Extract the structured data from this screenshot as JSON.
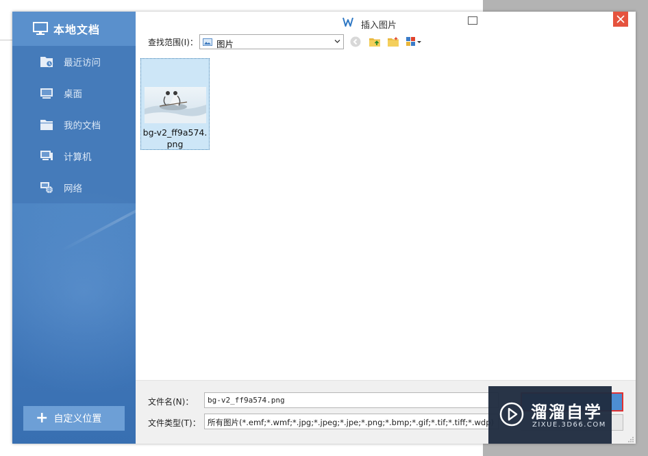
{
  "dialog": {
    "title": "插入图片",
    "window_controls": {
      "maximize_icon": "maximize-icon",
      "close_icon": "close-icon"
    }
  },
  "sidebar": {
    "header": "本地文档",
    "items": [
      {
        "label": "最近访问",
        "icon": "recent-folder-icon"
      },
      {
        "label": "桌面",
        "icon": "desktop-icon"
      },
      {
        "label": "我的文档",
        "icon": "documents-folder-icon"
      },
      {
        "label": "计算机",
        "icon": "computer-icon"
      },
      {
        "label": "网络",
        "icon": "network-icon"
      }
    ],
    "add_location": "自定义位置"
  },
  "toolbar": {
    "look_in_label": "查找范围(I)：",
    "look_in_value": "图片",
    "buttons": [
      "back-icon",
      "up-folder-icon",
      "new-folder-icon",
      "view-menu-icon"
    ]
  },
  "files": [
    {
      "name": "bg-v2_ff9a574.png",
      "selected": true
    }
  ],
  "footer": {
    "filename_label": "文件名(N)：",
    "filename_value": "bg-v2_ff9a574.png",
    "filetype_label": "文件类型(T)：",
    "filetype_value": "所有图片(*.emf;*.wmf;*.jpg;*.jpeg;*.jpe;*.png;*.bmp;*.gif;*.tif;*.tiff;*.wdp)"
  },
  "watermark": {
    "cn": "溜溜自学",
    "en": "ZIXUE.3D66.COM"
  },
  "colors": {
    "sidebar": "#4d85c4",
    "accent": "#4d8ed2",
    "close": "#e5533e",
    "highlight_border": "#e13030"
  }
}
